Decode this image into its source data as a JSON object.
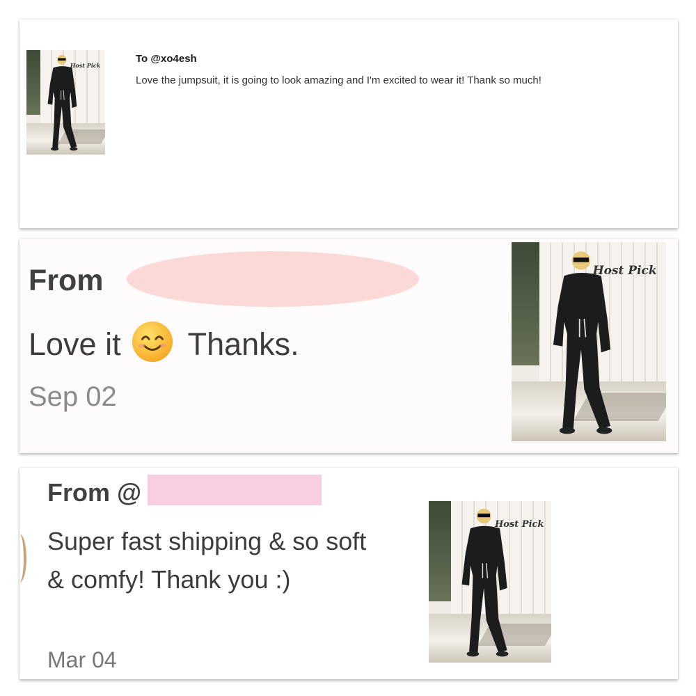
{
  "card1": {
    "title": "To @xo4esh",
    "message": "Love the jumpsuit, it is going to look amazing and I'm excited to wear it! Thank so much!",
    "photo_watermark": "Host Pick"
  },
  "card2": {
    "from_label": "From",
    "message_before_emoji": "Love it",
    "emoji": "smiling-face-emoji",
    "message_after_emoji": "Thanks.",
    "date": "Sep 02",
    "photo_watermark": "Host Pick",
    "redaction_color": "#fbd9d7"
  },
  "card3": {
    "from_label": "From @",
    "message": "Super fast shipping & so soft & comfy! Thank you :)",
    "date": "Mar 04",
    "photo_watermark": "Host Pick",
    "redaction_color": "#f7cfe0"
  }
}
